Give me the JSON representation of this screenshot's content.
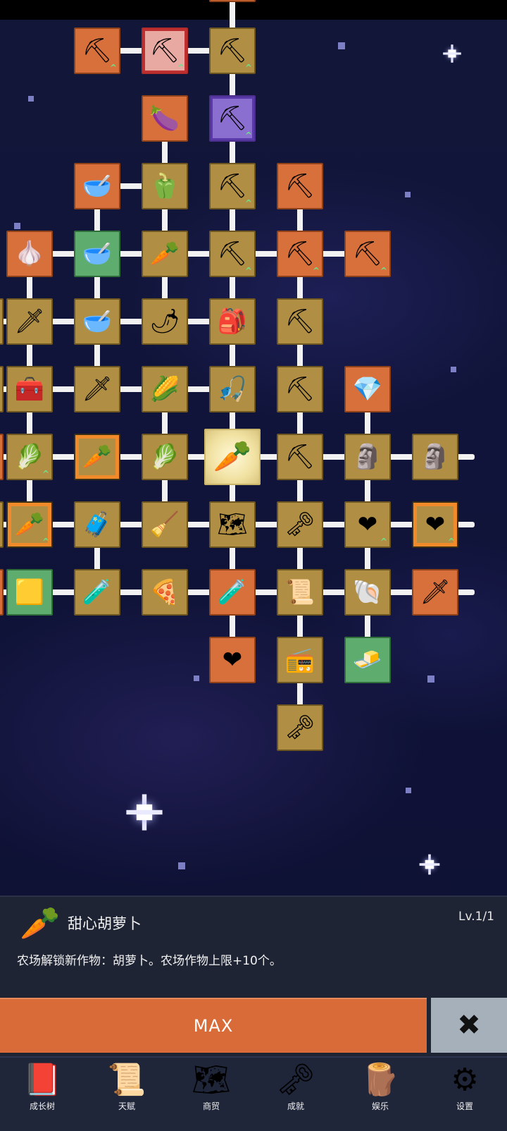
{
  "icons": {
    "shovel": "⛏",
    "eggplant": "🍆",
    "bowl": "🥣",
    "pepper": "🫑",
    "pickaxe": "⛏",
    "garlic": "🧄",
    "radish": "🥕",
    "sword": "🗡",
    "chili": "🌶",
    "backpack": "🎒",
    "chest": "🧰",
    "corn": "🌽",
    "fishing_rod": "🎣",
    "crystal": "💎",
    "cabbage": "🥬",
    "carrot": "🥕",
    "statue": "🗿",
    "treasure": "🧳",
    "broom": "🧹",
    "map": "🗺",
    "key": "🗝",
    "heart": "❤",
    "gold_bar": "🟨",
    "potion": "🧪",
    "pizza": "🍕",
    "scroll": "📜",
    "fossil": "🐚",
    "radio": "📻",
    "butter": "🧈"
  },
  "detail_panel": {
    "title": "甜心胡萝卜",
    "level": "Lv.1/1",
    "description": "农场解锁新作物：胡萝卜。农场作物上限+10个。",
    "icon": "carrot"
  },
  "actions": {
    "max_label": "MAX",
    "close_label": "✖"
  },
  "bottom_nav": [
    {
      "label": "成长树",
      "icon": "📕"
    },
    {
      "label": "天赋",
      "icon": "📜"
    },
    {
      "label": "商贸",
      "icon": "🗺"
    },
    {
      "label": "成就",
      "icon": "🗝"
    },
    {
      "label": "娱乐",
      "icon": "🪵"
    },
    {
      "label": "设置",
      "icon": "⚙"
    }
  ],
  "colors": {
    "panel_bg": "#1e2434",
    "max_button": "#d96b38",
    "close_button": "#a6b0ba",
    "node_gold": "#b08f44",
    "node_orange": "#d7703a",
    "node_green": "#5fad6e"
  }
}
